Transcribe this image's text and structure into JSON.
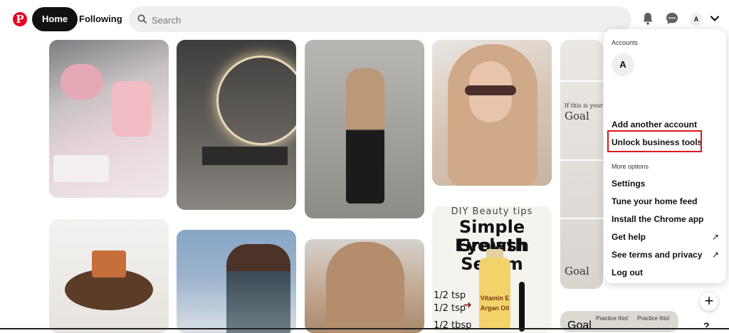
{
  "header": {
    "logo_letter": "P",
    "home_label": "Home",
    "following_label": "Following",
    "search_placeholder": "Search",
    "avatar_letter": "A",
    "icons": [
      "notifications-bell-icon",
      "messages-icon",
      "chevron-down-icon"
    ]
  },
  "pins": {
    "beauty": {
      "line1": "DIY Beauty tips",
      "line2": "Simple Eyelash",
      "line3": "Growth Serum",
      "bottle_label1": "Vitamin E",
      "bottle_label2": "Argan Oil",
      "measures": [
        "1/2 tsp",
        "1/2 tsp",
        "1/2 tbsp"
      ]
    },
    "goal_text": [
      "Goal",
      "Goal",
      "Goal"
    ],
    "practice_text": [
      "Practice this!",
      "Practice this!"
    ],
    "if_this_is_your": "If this is your"
  },
  "menu": {
    "accounts_heading": "Accounts",
    "account_avatar_letter": "A",
    "add_account": "Add another account",
    "unlock_business": "Unlock business tools",
    "more_options_heading": "More options",
    "settings": "Settings",
    "tune_feed": "Tune your home feed",
    "install_chrome": "Install the Chrome app",
    "get_help": "Get help",
    "terms_privacy": "See terms and privacy",
    "log_out": "Log out",
    "external_arrow": "↗"
  },
  "floating": {
    "plus": "+",
    "help": "?"
  },
  "colors": {
    "brand": "#e60023",
    "highlight_box": "#e0161b"
  }
}
